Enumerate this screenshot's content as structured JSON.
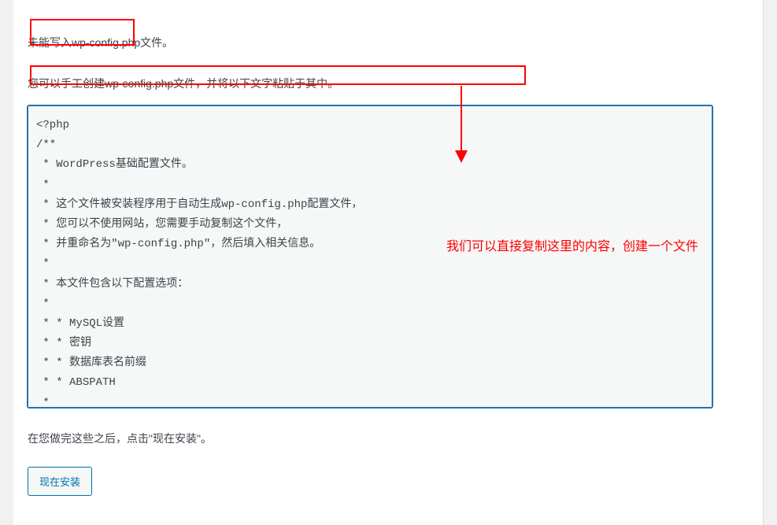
{
  "error_message": "未能写入wp-config.php文件。",
  "instruction_message": "您可以手工创建wp-config.php文件，并将以下文字粘贴于其中。",
  "code_content": "<?php\n/**\n * WordPress基础配置文件。\n *\n * 这个文件被安装程序用于自动生成wp-config.php配置文件，\n * 您可以不使用网站，您需要手动复制这个文件，\n * 并重命名为\"wp-config.php\"，然后填入相关信息。\n *\n * 本文件包含以下配置选项：\n *\n * * MySQL设置\n * * 密钥\n * * 数据库表名前缀\n * * ABSPATH\n *",
  "after_instruction": "在您做完这些之后，点击\"现在安装\"。",
  "install_button_label": "现在安装",
  "annotation_text": "我们可以直接复制这里的内容，创建一个文件"
}
